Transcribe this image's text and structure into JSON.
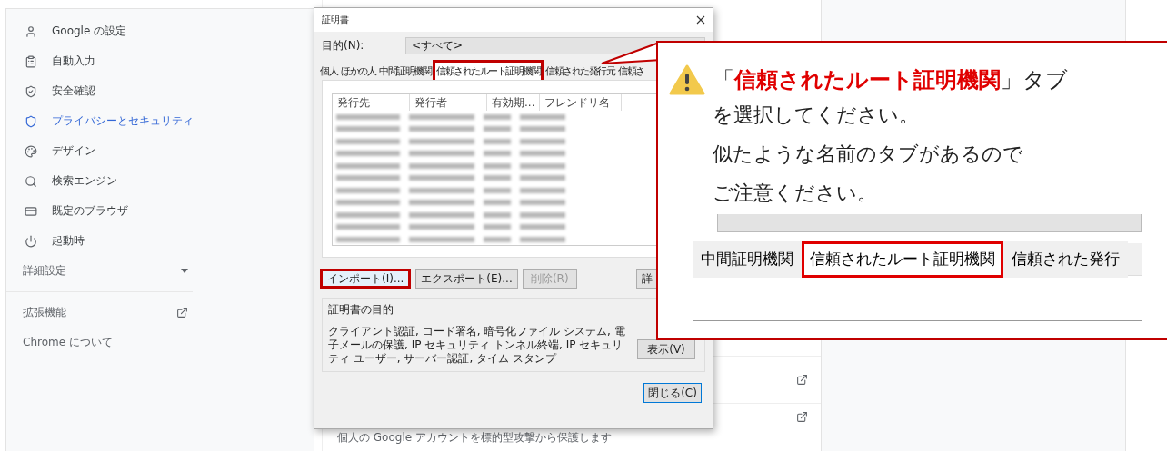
{
  "sidebar": {
    "items": [
      {
        "label": "Google の設定",
        "selected": false
      },
      {
        "label": "自動入力",
        "selected": false
      },
      {
        "label": "安全確認",
        "selected": false
      },
      {
        "label": "プライバシーとセキュリティ",
        "selected": true
      },
      {
        "label": "デザイン",
        "selected": false
      },
      {
        "label": "検索エンジン",
        "selected": false
      },
      {
        "label": "既定のブラウザ",
        "selected": false
      },
      {
        "label": "起動時",
        "selected": false
      }
    ],
    "advanced": "詳細設定",
    "extensions": "拡張機能",
    "about": "Chrome について"
  },
  "content": {
    "description": "個人の Google アカウントを標的型攻撃から保護します"
  },
  "dialog": {
    "title": "証明書",
    "purpose_label": "目的(N):",
    "purpose_value": "<すべて>",
    "tabs": [
      {
        "label": "個人",
        "selected": false,
        "highlighted": false
      },
      {
        "label": "ほかの人",
        "selected": false,
        "highlighted": false
      },
      {
        "label": "中間証明機関",
        "selected": false,
        "highlighted": false
      },
      {
        "label": "信頼されたルート証明機関",
        "selected": true,
        "highlighted": true
      },
      {
        "label": "信頼された発行元",
        "selected": false,
        "highlighted": false
      },
      {
        "label": "信頼さ",
        "selected": false,
        "highlighted": false
      }
    ],
    "columns": [
      "発行先",
      "発行者",
      "有効期...",
      "フレンドリ名"
    ],
    "buttons": [
      {
        "label": "インポート(I)...",
        "disabled": false,
        "highlighted": true
      },
      {
        "label": "エクスポート(E)...",
        "disabled": false,
        "highlighted": false
      },
      {
        "label": "削除(R)",
        "disabled": true,
        "highlighted": false
      }
    ],
    "details_button": "詳",
    "purpose_group": "証明書の目的",
    "purposes": "クライアント認証, コード署名, 暗号化ファイル システム, 電子メールの保護, IP セキュリティ トンネル終端, IP セキュリティ ユーザー, サーバー認証, タイム スタンプ",
    "view_button": "表示(V)",
    "close_button": "閉じる(C)"
  },
  "callout": {
    "headline": "「**信頼されたルート証明機関**」タブ",
    "lines": [
      "を選択してください。",
      "似たような名前のタブがあるので",
      "ご注意ください。"
    ],
    "inset_tabs": [
      {
        "label": "中間証明機関",
        "selected": false
      },
      {
        "label": "信頼されたルート証明機関",
        "selected": true
      },
      {
        "label": "信頼された発行",
        "selected": false
      }
    ]
  }
}
